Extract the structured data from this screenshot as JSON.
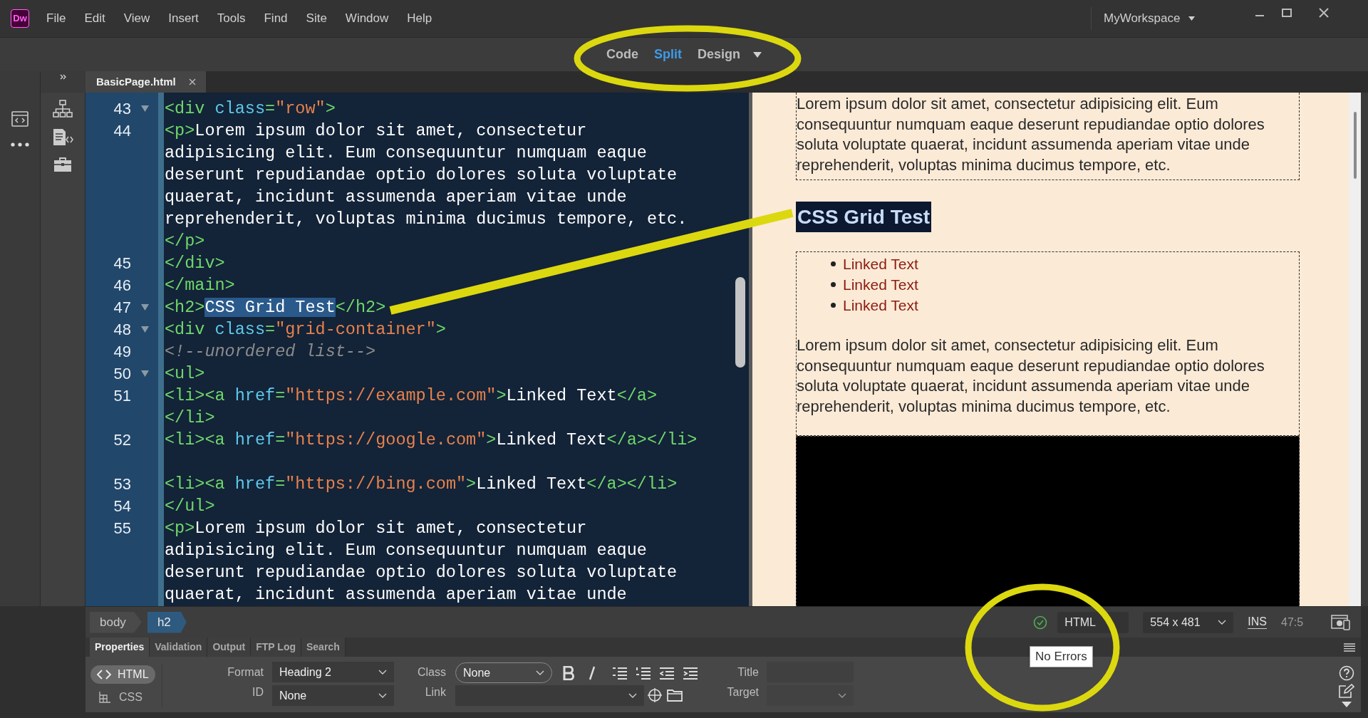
{
  "app": {
    "logo": "Dw",
    "menu": [
      "File",
      "Edit",
      "View",
      "Insert",
      "Tools",
      "Find",
      "Site",
      "Window",
      "Help"
    ],
    "workspace": "MyWorkspace"
  },
  "view_modes": [
    {
      "label": "Code",
      "selected": false
    },
    {
      "label": "Split",
      "selected": true
    },
    {
      "label": "Design",
      "selected": false
    }
  ],
  "document_tabs": [
    {
      "label": "BasicPage.html",
      "selected": true
    }
  ],
  "code_lines": [
    {
      "number": "43",
      "foldable": true,
      "blank_row_after": false,
      "rows": [
        [
          {
            "kind": "tag",
            "text": "<div "
          },
          {
            "kind": "attr",
            "text": "class"
          },
          {
            "kind": "tag",
            "text": "="
          },
          {
            "kind": "str",
            "text": "\"row\""
          },
          {
            "kind": "tag",
            "text": ">"
          }
        ]
      ]
    },
    {
      "number": "44",
      "foldable": false,
      "blank_row_after": false,
      "rows": [
        [
          {
            "kind": "tag",
            "text": "<p>"
          },
          {
            "kind": "text",
            "text": "Lorem ipsum dolor sit amet, consectetur"
          }
        ],
        [
          {
            "kind": "text",
            "text": "adipisicing elit. Eum consequuntur numquam eaque"
          }
        ],
        [
          {
            "kind": "text",
            "text": "deserunt repudiandae optio dolores soluta voluptate"
          }
        ],
        [
          {
            "kind": "text",
            "text": "quaerat, incidunt assumenda aperiam vitae unde"
          }
        ],
        [
          {
            "kind": "text",
            "text": "reprehenderit, voluptas minima ducimus tempore, etc."
          }
        ],
        [
          {
            "kind": "tag",
            "text": "</p>"
          }
        ]
      ]
    },
    {
      "number": "45",
      "foldable": false,
      "blank_row_after": false,
      "rows": [
        [
          {
            "kind": "tag",
            "text": "</div>"
          }
        ]
      ]
    },
    {
      "number": "46",
      "foldable": false,
      "blank_row_after": false,
      "rows": [
        [
          {
            "kind": "tag",
            "text": "</main>"
          }
        ]
      ]
    },
    {
      "number": "47",
      "foldable": true,
      "blank_row_after": false,
      "rows": [
        [
          {
            "kind": "tag",
            "text": "<h2>"
          },
          {
            "kind": "sel",
            "text": "CSS Grid Test"
          },
          {
            "kind": "tag",
            "text": "</h2>"
          }
        ]
      ]
    },
    {
      "number": "48",
      "foldable": true,
      "blank_row_after": false,
      "rows": [
        [
          {
            "kind": "tag",
            "text": "<div "
          },
          {
            "kind": "attr",
            "text": "class"
          },
          {
            "kind": "tag",
            "text": "="
          },
          {
            "kind": "str",
            "text": "\"grid-container\""
          },
          {
            "kind": "tag",
            "text": ">"
          }
        ]
      ]
    },
    {
      "number": "49",
      "foldable": false,
      "blank_row_after": false,
      "rows": [
        [
          {
            "kind": "comment",
            "text": "<!--unordered list-->"
          }
        ]
      ]
    },
    {
      "number": "50",
      "foldable": true,
      "blank_row_after": false,
      "rows": [
        [
          {
            "kind": "tag",
            "text": "<ul>"
          }
        ]
      ]
    },
    {
      "number": "51",
      "foldable": false,
      "blank_row_after": false,
      "rows": [
        [
          {
            "kind": "tag",
            "text": "<li><a "
          },
          {
            "kind": "attr",
            "text": "href"
          },
          {
            "kind": "tag",
            "text": "="
          },
          {
            "kind": "str",
            "text": "\"https://example.com\""
          },
          {
            "kind": "tag",
            "text": ">"
          },
          {
            "kind": "text",
            "text": "Linked Text"
          },
          {
            "kind": "tag",
            "text": "</a>"
          }
        ],
        [
          {
            "kind": "tag",
            "text": "</li>"
          }
        ]
      ]
    },
    {
      "number": "52",
      "foldable": false,
      "blank_row_after": true,
      "rows": [
        [
          {
            "kind": "tag",
            "text": "<li><a "
          },
          {
            "kind": "attr",
            "text": "href"
          },
          {
            "kind": "tag",
            "text": "="
          },
          {
            "kind": "str",
            "text": "\"https://google.com\""
          },
          {
            "kind": "tag",
            "text": ">"
          },
          {
            "kind": "text",
            "text": "Linked Text"
          },
          {
            "kind": "tag",
            "text": "</a></li>"
          }
        ]
      ]
    },
    {
      "number": "53",
      "foldable": false,
      "blank_row_after": false,
      "rows": [
        [
          {
            "kind": "tag",
            "text": "<li><a "
          },
          {
            "kind": "attr",
            "text": "href"
          },
          {
            "kind": "tag",
            "text": "="
          },
          {
            "kind": "str",
            "text": "\"https://bing.com\""
          },
          {
            "kind": "tag",
            "text": ">"
          },
          {
            "kind": "text",
            "text": "Linked Text"
          },
          {
            "kind": "tag",
            "text": "</a></li>"
          }
        ]
      ]
    },
    {
      "number": "54",
      "foldable": false,
      "blank_row_after": false,
      "rows": [
        [
          {
            "kind": "tag",
            "text": "</ul>"
          }
        ]
      ]
    },
    {
      "number": "55",
      "foldable": false,
      "blank_row_after": false,
      "rows": [
        [
          {
            "kind": "tag",
            "text": "<p>"
          },
          {
            "kind": "text",
            "text": "Lorem ipsum dolor sit amet, consectetur"
          }
        ],
        [
          {
            "kind": "text",
            "text": "adipisicing elit. Eum consequuntur numquam eaque"
          }
        ],
        [
          {
            "kind": "text",
            "text": "deserunt repudiandae optio dolores soluta voluptate"
          }
        ],
        [
          {
            "kind": "text",
            "text": "quaerat, incidunt assumenda aperiam vitae unde"
          }
        ]
      ]
    }
  ],
  "design_view": {
    "sections": [
      {
        "kind": "box",
        "blocks": [
          {
            "kind": "paragraph",
            "lines": [
              "Lorem ipsum dolor sit amet, consectetur adipisicing elit. Eum",
              "consequuntur numquam eaque deserunt repudiandae optio dolores",
              "soluta voluptate quaerat, incidunt assumenda aperiam vitae unde",
              "reprehenderit, voluptas minima ducimus tempore, etc."
            ]
          }
        ]
      },
      {
        "kind": "heading",
        "text": "CSS Grid Test",
        "selected": true
      },
      {
        "kind": "box",
        "blocks": [
          {
            "kind": "list",
            "items": [
              "Linked Text",
              "Linked Text",
              "Linked Text"
            ]
          },
          {
            "kind": "paragraph",
            "lines": [
              "Lorem ipsum dolor sit amet, consectetur adipisicing elit. Eum",
              "consequuntur numquam eaque deserunt repudiandae optio dolores",
              "soluta voluptate quaerat, incidunt assumenda aperiam vitae unde",
              "reprehenderit, voluptas minima ducimus tempore, etc."
            ]
          }
        ]
      },
      {
        "kind": "image"
      }
    ]
  },
  "status_bar": {
    "breadcrumbs": [
      {
        "label": "body",
        "selected": false
      },
      {
        "label": "h2",
        "selected": true
      }
    ],
    "valid": true,
    "doc_type": "HTML",
    "size": "554 x 481",
    "mode": "INS",
    "position": "47:5",
    "tooltip": "No Errors"
  },
  "panel_tabs": [
    {
      "label": "Properties",
      "selected": true
    },
    {
      "label": "Validation",
      "selected": false
    },
    {
      "label": "Output",
      "selected": false
    },
    {
      "label": "FTP Log",
      "selected": false
    },
    {
      "label": "Search",
      "selected": false
    }
  ],
  "properties": {
    "modes": [
      {
        "label": "HTML",
        "selected": true
      },
      {
        "label": "CSS",
        "selected": false
      }
    ],
    "format_label": "Format",
    "format": "Heading 2",
    "id_label": "ID",
    "id": "None",
    "class_label": "Class",
    "class": "None",
    "link_label": "Link",
    "title_label": "Title",
    "target_label": "Target"
  },
  "annotations": [
    {
      "kind": "ellipse"
    },
    {
      "kind": "line"
    },
    {
      "kind": "ellipse"
    }
  ]
}
